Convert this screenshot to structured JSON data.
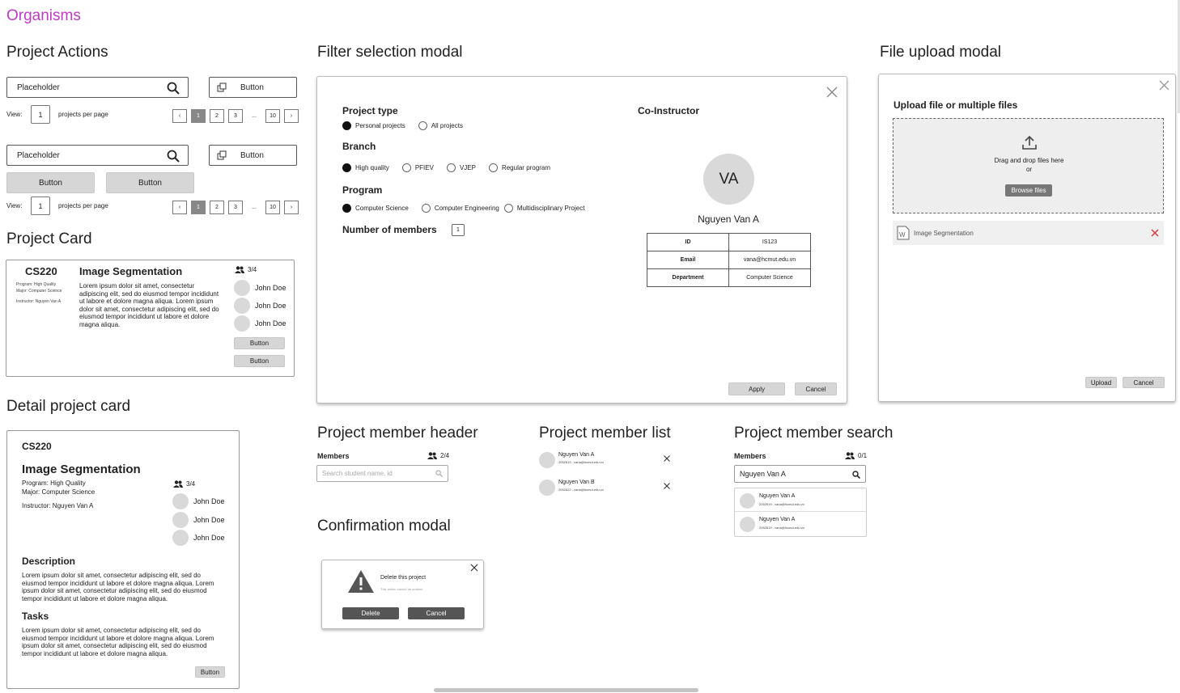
{
  "page_title": "Organisms",
  "project_actions": {
    "title": "Project Actions",
    "search_placeholder": "Placeholder",
    "button_label": "Button",
    "view_label": "View:",
    "per_page_value": "1",
    "per_page_label": "projects per page",
    "pagination": [
      "1",
      "2",
      "3",
      "...",
      "10"
    ],
    "grey_buttons": [
      "Button",
      "Button"
    ]
  },
  "project_card": {
    "title": "Project Card",
    "code": "CS220",
    "program": "Program: High Quality",
    "major": "Major: Computer Science",
    "instructor": "Instructor: Nguyen Van A",
    "name": "Image Segmentation",
    "description": "Lorem ipsum dolor sit amet, consectetur adipiscing elit, sed do eiusmod tempor incididunt ut labore et dolore magna aliqua. Lorem ipsum dolor sit amet, consectetur adipiscing elit, sed do eiusmod tempor incididunt ut labore et dolore magna aliqua.",
    "member_count": "3/4",
    "members": [
      "John Doe",
      "John Doe",
      "John Doe"
    ],
    "buttons": [
      "Button",
      "Button"
    ]
  },
  "detail_card": {
    "title": "Detail project card",
    "code": "CS220",
    "name": "Image Segmentation",
    "program": "Program: High Quality",
    "major": "Major: Computer Science",
    "instructor": "Instructor: Nguyen Van A",
    "member_count": "3/4",
    "members": [
      "John Doe",
      "John Doe",
      "John Doe"
    ],
    "description_title": "Description",
    "description": "Lorem ipsum dolor sit amet, consectetur adipiscing elit, sed do eiusmod tempor incididunt ut labore et dolore magna aliqua. Lorem ipsum dolor sit amet, consectetur adipiscing elit, sed do eiusmod tempor incididunt ut labore et dolore magna aliqua.",
    "tasks_title": "Tasks",
    "tasks": "Lorem ipsum dolor sit amet, consectetur adipiscing elit, sed do eiusmod tempor incididunt ut labore et dolore magna aliqua. Lorem ipsum dolor sit amet, consectetur adipiscing elit, sed do eiusmod tempor incididunt ut labore et dolore magna aliqua.",
    "button_label": "Button"
  },
  "filter_modal": {
    "title": "Filter selection modal",
    "project_type_label": "Project type",
    "project_types": [
      "Personal projects",
      "All projects"
    ],
    "branch_label": "Branch",
    "branches": [
      "High quality",
      "PFIEV",
      "VJEP",
      "Regular program"
    ],
    "program_label": "Program",
    "programs": [
      "Computer Science",
      "Computer Engineering",
      "Multidisciplinary Project"
    ],
    "members_label": "Number of members",
    "members_value": "1",
    "co_instructor_label": "Co-Instructor",
    "avatar_initials": "VA",
    "instructor_name": "Nguyen Van A",
    "info": [
      {
        "key": "ID",
        "value": "IS123"
      },
      {
        "key": "Email",
        "value": "vana@hcmut.edu.vn"
      },
      {
        "key": "Department",
        "value": "Computer Science"
      }
    ],
    "apply_label": "Apply",
    "cancel_label": "Cancel"
  },
  "upload_modal": {
    "title": "File upload modal",
    "heading": "Upload file or multiple files",
    "drop_text": "Drag and drop files here",
    "or_text": "or",
    "browse_label": "Browse files",
    "file_name": "Image Segmentation",
    "upload_label": "Upload",
    "cancel_label": "Cancel"
  },
  "member_header": {
    "title": "Project member header",
    "members_label": "Members",
    "count": "2/4",
    "search_placeholder": "Search student name, id"
  },
  "member_list": {
    "title": "Project member list",
    "members": [
      {
        "name": "Nguyen Van A",
        "detail": "2052619 - vana@hcmut.edu.vn"
      },
      {
        "name": "Nguyen Van B",
        "detail": "2052622 - vanb@hcmut.edu.vn"
      }
    ]
  },
  "member_search": {
    "title": "Project member search",
    "members_label": "Members",
    "count": "0/1",
    "query": "Nguyen Van A",
    "results": [
      {
        "name": "Nguyen Van A",
        "detail": "2052619 - vana@hcmut.edu.vn"
      },
      {
        "name": "Nguyen Van A",
        "detail": "2052619 - vana@hcmut.edu.vn"
      }
    ]
  },
  "confirm_modal": {
    "title": "Confirmation modal",
    "heading": "Delete this project",
    "subtext": "This action cannot be undone",
    "delete_label": "Delete",
    "cancel_label": "Cancel"
  }
}
